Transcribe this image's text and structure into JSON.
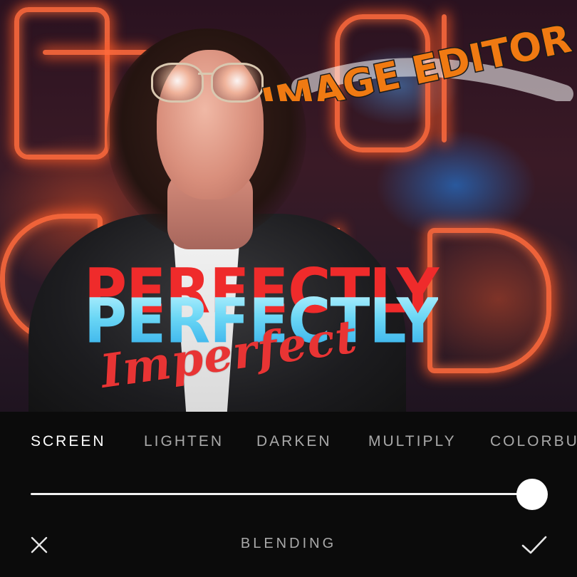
{
  "overlays": {
    "title_sticker": "IMAGE EDITOR",
    "headline_top": "PERFECTLY",
    "headline_bottom": "PERFECTLY",
    "script_text": "Imperfect"
  },
  "blend_modes": {
    "items": [
      "SCREEN",
      "LIGHTEN",
      "DARKEN",
      "MULTIPLY",
      "COLORBU"
    ],
    "selected": "SCREEN"
  },
  "opacity_slider": {
    "value_percent": 100
  },
  "footer": {
    "title": "BLENDING",
    "close_icon": "close-icon",
    "confirm_icon": "check-icon"
  },
  "colors": {
    "panel_bg": "#0b0b0b",
    "active_text": "#ffffff",
    "inactive_text": "#a9a9a9",
    "headline_red": "#ef2b2b",
    "headline_blue": "#6ad6f5",
    "sticker_orange": "#f07a12"
  }
}
